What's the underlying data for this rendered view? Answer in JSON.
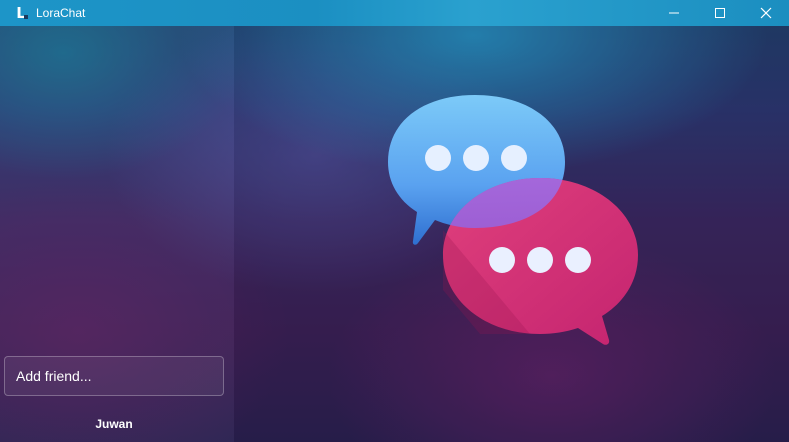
{
  "window": {
    "title": "LoraChat",
    "icon_glyph": "L",
    "controls": {
      "minimize": "—",
      "maximize": "☐",
      "close": "✕"
    }
  },
  "sidebar": {
    "add_friend_placeholder": "Add friend...",
    "current_user": "Juwan"
  },
  "main": {
    "logo_icon": "chat-bubbles-icon"
  },
  "colors": {
    "titlebar": "#1b8fc2",
    "bubble_blue": "#5aa6f0",
    "bubble_pink": "#d8336f"
  }
}
